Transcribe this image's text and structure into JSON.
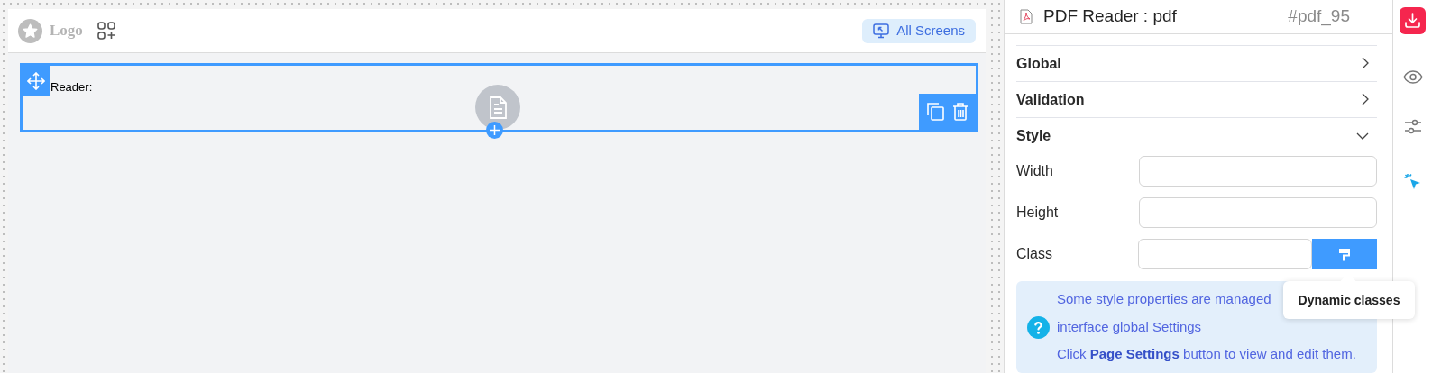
{
  "canvas": {
    "logo": {
      "text": "Logo"
    },
    "screens_button": {
      "label": "All Screens"
    },
    "component": {
      "label": "Reader:",
      "selected": true
    }
  },
  "panel": {
    "title": "PDF Reader : pdf",
    "id": "#pdf_95",
    "sections": [
      {
        "label": "Global",
        "expanded": false
      },
      {
        "label": "Validation",
        "expanded": false
      },
      {
        "label": "Style",
        "expanded": true
      }
    ],
    "fields": [
      {
        "label": "Width",
        "kind": "text"
      },
      {
        "label": "Height",
        "kind": "text"
      },
      {
        "label": "Class",
        "kind": "class"
      }
    ],
    "info": [
      "Some style properties are managed",
      "interface global Settings",
      "Click **Page Settings** button to view and edit them."
    ],
    "tooltip": "Dynamic classes"
  }
}
